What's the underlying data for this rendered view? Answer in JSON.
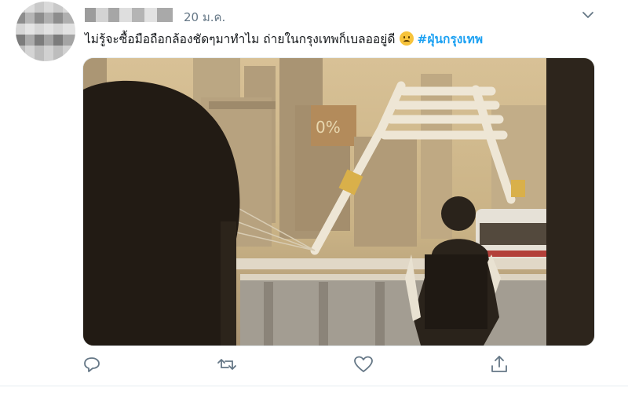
{
  "tweet": {
    "time": "20 ม.ค.",
    "text": "ไม่รู้จะซื้อมือถือกล้องชัดๆมาทำไม ถ่ายในกรุงเทพก็เบลออยู่ดี",
    "emoji": "frowning-face",
    "hashtag": "#ฝุ่นกรุงเทพ"
  },
  "actions": [
    "reply-icon",
    "retweet-icon",
    "like-icon",
    "share-icon"
  ],
  "colors": {
    "hashtag": "#1da1f2",
    "secondary_text": "#657786",
    "primary_text": "#14171a"
  }
}
